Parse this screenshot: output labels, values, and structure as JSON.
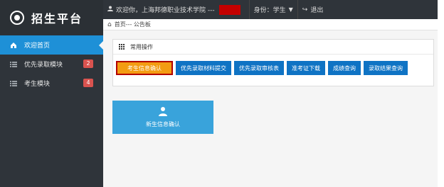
{
  "sidebar": {
    "title": "招生平台",
    "items": [
      {
        "label": "欢迎首页",
        "icon": "home-icon",
        "badge": ""
      },
      {
        "label": "优先录取模块",
        "icon": "list-icon",
        "badge": "2"
      },
      {
        "label": "考生模块",
        "icon": "list-icon",
        "badge": "4"
      }
    ]
  },
  "topbar": {
    "welcome": "欢迎你，上海邦德职业技术学院 ---",
    "role_label": "身份：",
    "role_value": "学生",
    "logout_label": "退出"
  },
  "breadcrumb": {
    "text": "首页--- 公告板"
  },
  "panel": {
    "header": "常用操作",
    "buttons": [
      {
        "label": "考生信息确认"
      },
      {
        "label": "优先录取材料提交"
      },
      {
        "label": "优先录取审核表"
      },
      {
        "label": "准考证下载"
      },
      {
        "label": "成绩查询"
      },
      {
        "label": "录取结果查询"
      }
    ]
  },
  "tile": {
    "label": "新生信息确认",
    "icon": "user-icon"
  },
  "colors": {
    "sidebar_bg": "#2f343a",
    "active_blue": "#1e90d7",
    "button_blue": "#0f73c4",
    "primary_orange": "#f39c12",
    "highlight_red": "#b30000",
    "tile_blue": "#39a3db"
  }
}
